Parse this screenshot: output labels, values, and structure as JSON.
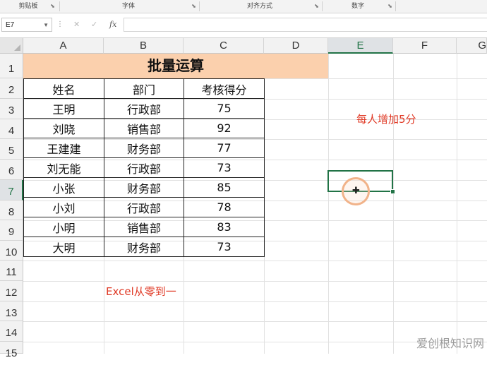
{
  "ribbon": {
    "groups": [
      {
        "label": "剪贴板"
      },
      {
        "label": "字体"
      },
      {
        "label": "对齐方式"
      },
      {
        "label": "数字"
      }
    ]
  },
  "formula_bar": {
    "name_box": "E7",
    "fx_label": "fx",
    "formula": ""
  },
  "columns": [
    "A",
    "B",
    "C",
    "D",
    "E",
    "F",
    "G"
  ],
  "rows": [
    "1",
    "2",
    "3",
    "4",
    "5",
    "6",
    "7",
    "8",
    "9",
    "10",
    "11",
    "12",
    "13",
    "14",
    "15"
  ],
  "table": {
    "title": "批量运算",
    "headers": [
      "姓名",
      "部门",
      "考核得分"
    ],
    "records": [
      [
        "王明",
        "行政部",
        "75"
      ],
      [
        "刘晓",
        "销售部",
        "92"
      ],
      [
        "王建建",
        "财务部",
        "77"
      ],
      [
        "刘无能",
        "行政部",
        "73"
      ],
      [
        "小张",
        "财务部",
        "85"
      ],
      [
        "小刘",
        "行政部",
        "78"
      ],
      [
        "小明",
        "销售部",
        "83"
      ],
      [
        "大明",
        "财务部",
        "73"
      ]
    ]
  },
  "annotations": {
    "tip": "每人增加5分",
    "brand": "Excel从零到一"
  },
  "watermark": "爱创根知识网",
  "selected_cell": "E7",
  "colors": {
    "title_fill": "#fbd0ad",
    "selection": "#217346",
    "annotation": "#e03a26"
  }
}
